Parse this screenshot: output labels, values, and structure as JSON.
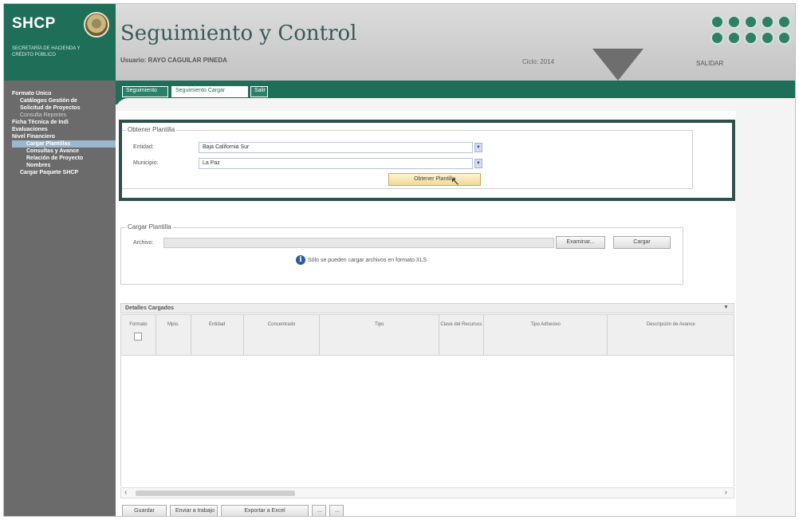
{
  "header": {
    "logo": "SHCP",
    "logo_subtitle": "Secretaría de Hacienda y Crédito Público",
    "app_title": "Seguimiento y Control",
    "user_line": "Usuario: RAYO CAGUILAR PINEDA",
    "ciclo": "Ciclo: 2014",
    "salir": "SALIDAR",
    "icons": [
      "user-icon",
      "phone-icon",
      "globe-icon",
      "home-icon",
      "close-icon",
      "settings-icon",
      "minus-icon",
      "help-icon",
      "info-icon",
      "power-icon"
    ]
  },
  "tabs": [
    "Seguimiento",
    "Seguimiento Cargar",
    "Salir"
  ],
  "sidebar": {
    "items": [
      {
        "label": "Formato Único",
        "level": 0,
        "state": "normal"
      },
      {
        "label": "Catálogos Gestión de",
        "level": 1,
        "state": "normal"
      },
      {
        "label": "Solicitud de Proyectos",
        "level": 1,
        "state": "normal"
      },
      {
        "label": "Consulta Reportes",
        "level": 1,
        "state": "muted"
      },
      {
        "label": "Ficha Técnica de Indi",
        "level": 0,
        "state": "normal"
      },
      {
        "label": "Evaluaciones",
        "level": 0,
        "state": "normal"
      },
      {
        "label": "Nivel Financiero",
        "level": 0,
        "state": "normal"
      },
      {
        "label": "Cargar Plantillas",
        "level": 2,
        "state": "active"
      },
      {
        "label": "Consultas y Avance",
        "level": 2,
        "state": "normal"
      },
      {
        "label": "Relación de Proyecto",
        "level": 2,
        "state": "normal"
      },
      {
        "label": "Nombres",
        "level": 2,
        "state": "normal"
      },
      {
        "label": "Cargar Paquete SHCP",
        "level": 1,
        "state": "normal"
      }
    ]
  },
  "obtener": {
    "legend": "Obtener Plantilla",
    "entidad_label": "Entidad:",
    "entidad_value": "Baja California Sur",
    "municipio_label": "Municipio:",
    "municipio_value": "La Paz",
    "button": "Obtener Plantilla"
  },
  "cargar": {
    "legend": "Cargar Plantilla",
    "archivo_label": "Archivo:",
    "examinar": "Examinar...",
    "cargar": "Cargar",
    "info": "Sólo se pueden cargar archivos en formato XLS"
  },
  "grid": {
    "title": "Detalles Cargados",
    "columns": [
      "Formato",
      "Mpio.",
      "Entidad",
      "Concentrado",
      "Tipo",
      "Clave del Recursos",
      "Tipo Adhesivo",
      "Descripción de Avance"
    ],
    "buttons": [
      "Guardar",
      "Enviar a trabajo",
      "Exportar a Excel",
      "...",
      "..."
    ]
  }
}
